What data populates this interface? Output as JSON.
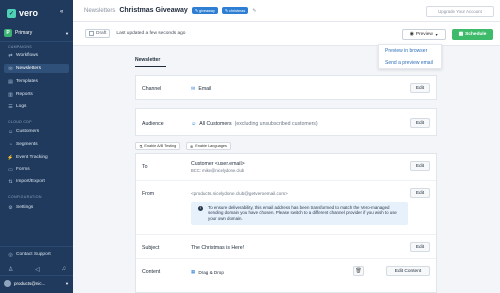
{
  "sidebar": {
    "brand": "vero",
    "account": {
      "badge": "P",
      "name": "Primary"
    },
    "sections": [
      {
        "title": "CAMPAIGNS",
        "items": [
          "Workflows",
          "Newsletters",
          "Templates",
          "Reports",
          "Logs"
        ]
      },
      {
        "title": "CLOUD CDP",
        "items": [
          "Customers",
          "Segments",
          "Event Tracking",
          "Forms",
          "Import/Export"
        ]
      },
      {
        "title": "CONFIGURATION",
        "items": [
          "Settings"
        ]
      }
    ],
    "active_item": "Newsletters",
    "support_label": "Contact Support",
    "user_label": "products@nic..."
  },
  "header": {
    "breadcrumb": "Newsletters",
    "title": "Christmas Giveaway",
    "tags": [
      "giveaway",
      "christmas"
    ],
    "upgrade_label": "Upgrade Your Account"
  },
  "toolbar": {
    "draft_label": "Draft",
    "updated_text": "Last updated a few seconds ago",
    "preview_label": "Preview",
    "schedule_label": "Schedule"
  },
  "preview_menu": [
    "Preview in browser",
    "Send a preview email"
  ],
  "tab_label": "Newsletter",
  "rows": {
    "channel": {
      "label": "Channel",
      "value": "Email",
      "edit": "Edit"
    },
    "audience": {
      "label": "Audience",
      "value": "All Customers",
      "note": "(excluding unsubscribed customers)",
      "edit": "Edit"
    },
    "ab_label": "Enable A/B Testing",
    "lang_label": "Enable Languages",
    "to": {
      "label": "To",
      "value": "Customer <user.email>",
      "bcc": "BCC: mike@nicelydone.club",
      "edit": "Edit"
    },
    "from": {
      "label": "From",
      "value": "<products.nicelydone.club@getveroemail.com>",
      "notice": "To ensure deliverability, this email address has been transformed to match the Vero-managed sending domain you have chosen. Please switch to a different channel provider if you wish to use your own domain.",
      "edit": "Edit"
    },
    "subject": {
      "label": "Subject",
      "value": "The Christmas is Here!",
      "edit": "Edit"
    },
    "content": {
      "label": "Content",
      "value": "Drag & Drop",
      "edit": "Edit Content"
    }
  },
  "colors": {
    "sidebar": "#1f3a5c",
    "accent": "#2e7fd3",
    "schedule": "#3dbb6a"
  }
}
